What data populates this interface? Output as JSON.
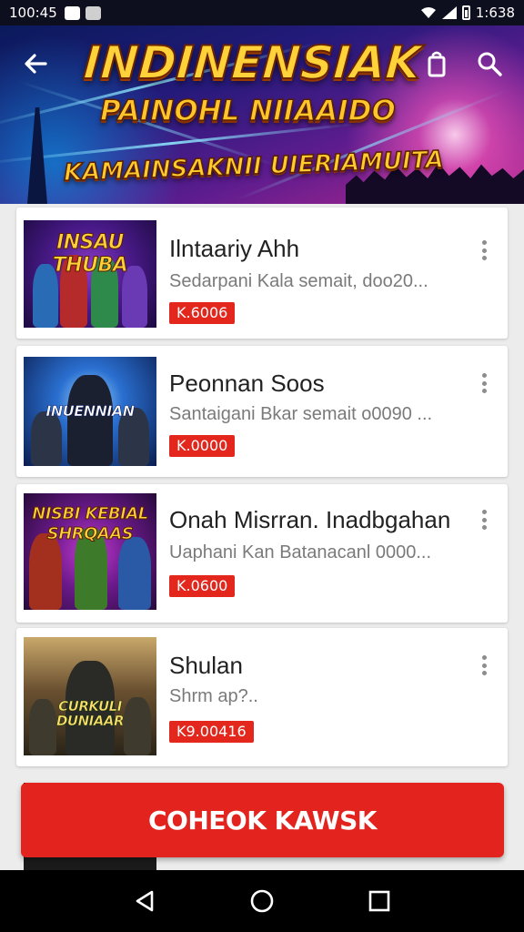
{
  "status_bar": {
    "time": "100:45",
    "right_text": "1:638"
  },
  "header": {
    "title_line1": "INDINENSIAK",
    "title_line2": "PAINOHL NIIAAIDO",
    "title_line3": "KAMAINSAKNII UIERIAMUITA",
    "back_icon": "arrow-left-icon",
    "cart_icon": "shopping-bag-icon",
    "search_icon": "search-icon"
  },
  "items": [
    {
      "title": "Ilntaariy Ahh",
      "subtitle": "Sedarpani Kala semait, doo20...",
      "price": "K.6006",
      "art_text": "INSAU THUBA"
    },
    {
      "title": "Peonnan Soos",
      "subtitle": "Santaigani Bkar semait o0090 ...",
      "price": "K.0000",
      "art_text": "INUENNIAN"
    },
    {
      "title": "Onah Misrran. Inadbgahan",
      "subtitle": "Uaphani Kan Batanacanl 0000...",
      "price": "K.0600",
      "art_text": "NISBI KEBIAL SHRQAAS"
    },
    {
      "title": "Shulan",
      "subtitle": "Shrm ap?..",
      "price": "K9.00416",
      "art_text": "CURKULI DUNIAAR"
    }
  ],
  "cta": {
    "label": "COHEOK KAWSK"
  },
  "nav": {
    "back": "back-triangle-icon",
    "home": "home-circle-icon",
    "recents": "recents-square-icon"
  },
  "colors": {
    "accent": "#e3231e",
    "price_badge": "#e3271d",
    "banner_gold": "#ffd23a"
  }
}
